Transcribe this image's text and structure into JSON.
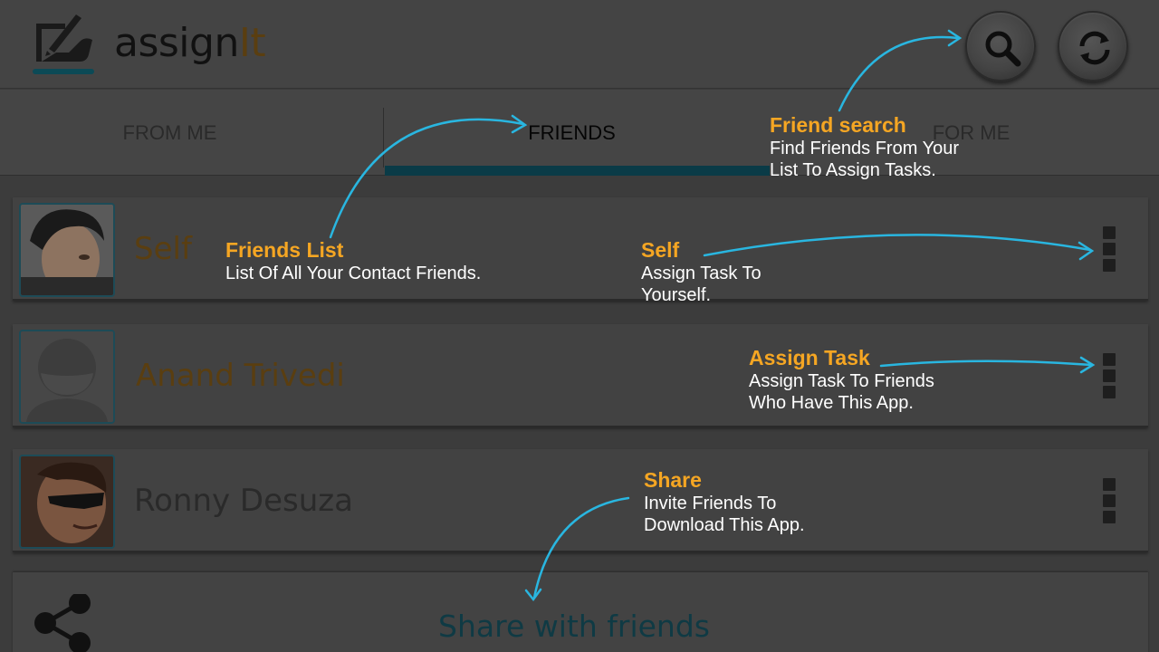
{
  "app": {
    "title_main": "assign",
    "title_highlight": "It"
  },
  "actionbar": {
    "search_icon": "search-icon",
    "refresh_icon": "refresh-icon"
  },
  "tabs": [
    {
      "label": "FROM ME",
      "active": false
    },
    {
      "label": "FRIENDS",
      "active": true
    },
    {
      "label": "FOR ME",
      "active": false
    }
  ],
  "friends": [
    {
      "name": "Self",
      "name_color": "#5a3e10",
      "avatar": "photo"
    },
    {
      "name": "Anand Trivedi",
      "name_color": "#5a3e10",
      "avatar": "placeholder"
    },
    {
      "name": "Ronny Desuza",
      "name_color": "#2a2a2a",
      "avatar": "photo"
    }
  ],
  "share": {
    "label": "Share with friends",
    "icon": "share-icon"
  },
  "annotations": {
    "friend_search": {
      "title": "Friend search",
      "text": "Find Friends From Your\nList To Assign Tasks."
    },
    "friends_list": {
      "title": "Friends List",
      "text": "List Of All Your Contact Friends."
    },
    "self": {
      "title": "Self",
      "text": "Assign Task To\nYourself."
    },
    "assign_task": {
      "title": "Assign Task",
      "text": "Assign Task To Friends\nWho Have This App."
    },
    "share": {
      "title": "Share",
      "text": "Invite Friends To\nDownload This App."
    }
  },
  "colors": {
    "accent": "#0a3b47",
    "annotation_title": "#f5a623",
    "annotation_text": "#ffffff",
    "arrow": "#29b6e0"
  }
}
